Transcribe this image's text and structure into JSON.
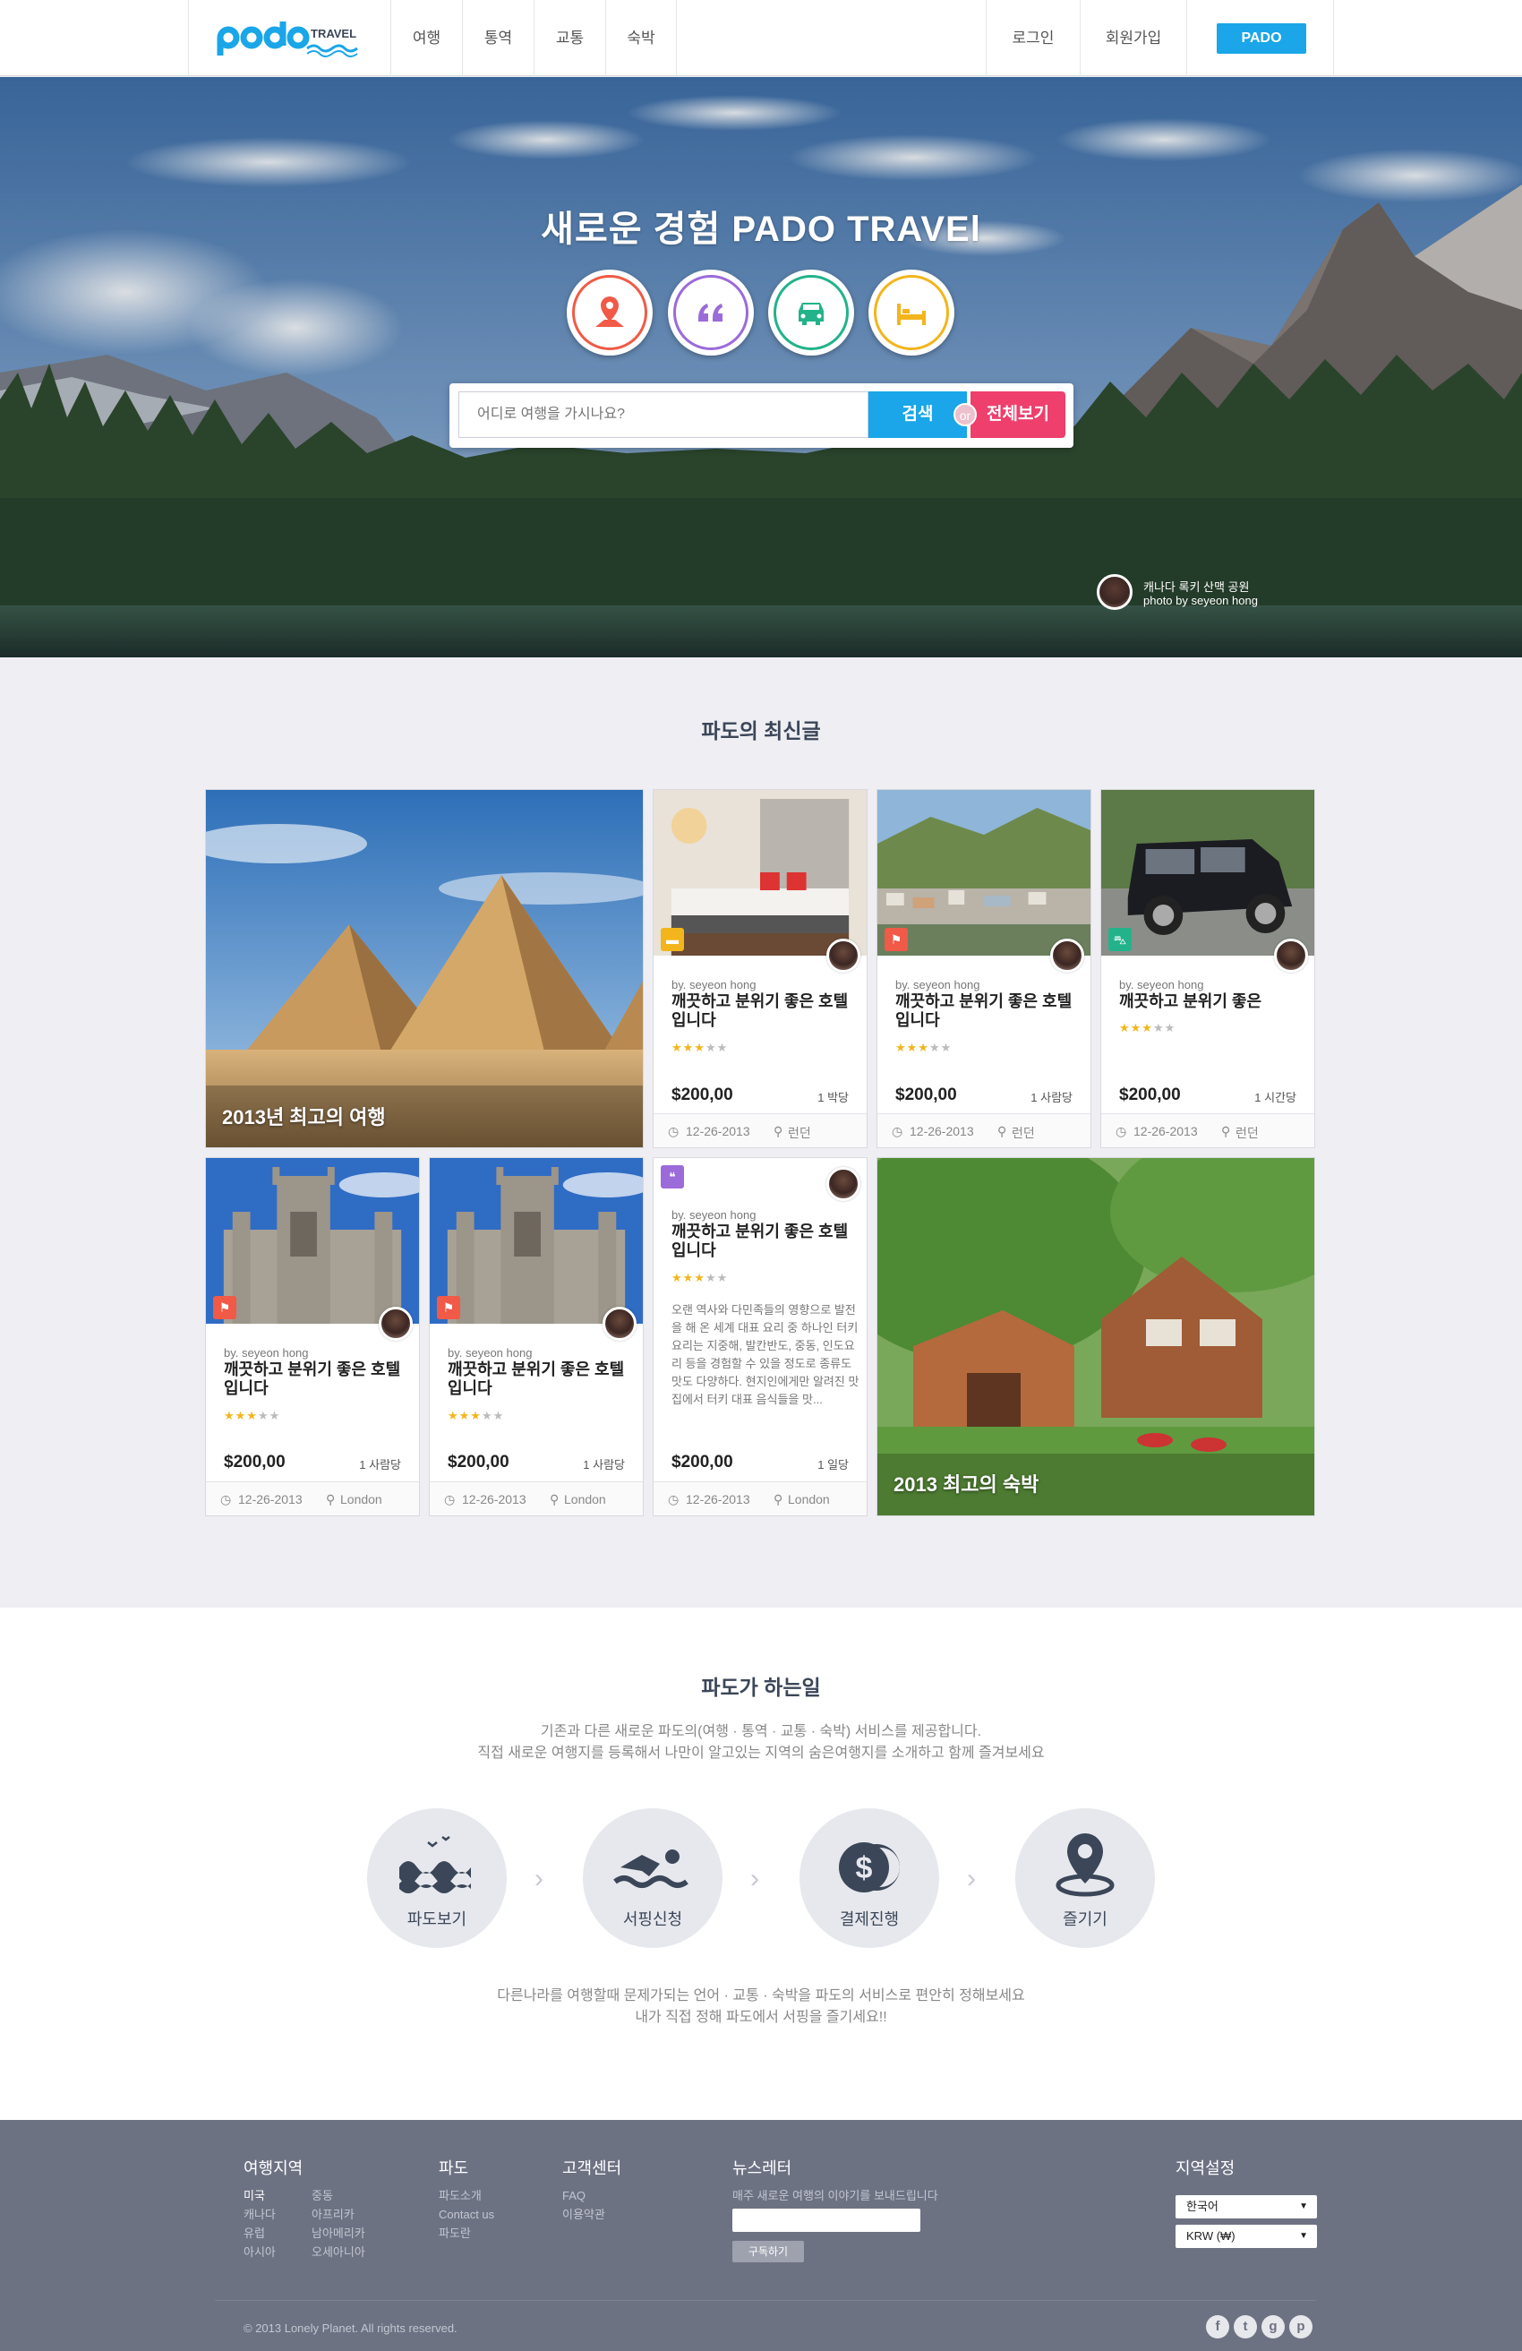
{
  "header": {
    "logo_text": "TRAVEL",
    "nav": [
      "여행",
      "통역",
      "교통",
      "숙박"
    ],
    "login": "로그인",
    "signup": "회원가입",
    "pado_button": "PADO"
  },
  "hero": {
    "title": "새로운 경험 PADO TRAVEl",
    "categories": [
      {
        "icon": "map-pin-icon",
        "color": "#f05a46"
      },
      {
        "icon": "quote-icon",
        "color": "#9b6bd9"
      },
      {
        "icon": "car-icon",
        "color": "#22b38a"
      },
      {
        "icon": "bed-icon",
        "color": "#f2b51c"
      }
    ],
    "search_placeholder": "어디로 여행을 가시나요?",
    "search_button": "검색",
    "or_text": "or",
    "all_button": "전체보기",
    "credit_line1": "캐나다 록키 산맥 공원",
    "credit_line2": "photo by seyeon hong"
  },
  "latest": {
    "title": "파도의 최신글",
    "feature_1": "2013년 최고의 여행",
    "feature_2": "2013 최고의 숙박",
    "cards": [
      {
        "badge": "bed-icon",
        "badge_color": "#f2b51c",
        "by": "by. seyeon hong",
        "title": "깨끗하고 분위기 좋은 호텔 입니다",
        "stars": 3,
        "price": "$200,00",
        "unit": "1 박당",
        "date": "12-26-2013",
        "location": "런던"
      },
      {
        "badge": "map-pin-icon",
        "badge_color": "#f05a46",
        "by": "by. seyeon hong",
        "title": "깨끗하고 분위기 좋은 호텔 입니다",
        "stars": 3,
        "price": "$200,00",
        "unit": "1 사람당",
        "date": "12-26-2013",
        "location": "런던"
      },
      {
        "badge": "car-icon",
        "badge_color": "#22b38a",
        "by": "by. seyeon hong",
        "title": "깨끗하고 분위기 좋은",
        "stars": 3,
        "price": "$200,00",
        "unit": "1 시간당",
        "date": "12-26-2013",
        "location": "런던"
      },
      {
        "badge": "map-pin-icon",
        "badge_color": "#f05a46",
        "by": "by. seyeon hong",
        "title": "깨끗하고 분위기 좋은 호텔 입니다",
        "stars": 3,
        "price": "$200,00",
        "unit": "1 사람당",
        "date": "12-26-2013",
        "location": "London"
      },
      {
        "badge": "map-pin-icon",
        "badge_color": "#f05a46",
        "by": "by. seyeon hong",
        "title": "깨끗하고 분위기 좋은 호텔 입니다",
        "stars": 3,
        "price": "$200,00",
        "unit": "1 사람당",
        "date": "12-26-2013",
        "location": "London"
      },
      {
        "badge": "quote-icon",
        "badge_color": "#9b6bd9",
        "by": "by. seyeon hong",
        "title": "깨끗하고 분위기 좋은 호텔 입니다",
        "stars": 3,
        "desc": "오랜 역사와 다민족들의 영향으로 발전을 해 온 세계 대표 요리 중 하나인 터키요리는 지중해, 발칸반도, 중동, 인도요리 등을 경험할 수 있을 정도로 종류도 맛도 다양하다. 현지인에게만 알려진 맛집에서 터키 대표 음식들을 맛...",
        "price": "$200,00",
        "unit": "1 일당",
        "date": "12-26-2013",
        "location": "London"
      }
    ]
  },
  "what": {
    "title": "파도가 하는일",
    "intro_line1": "기존과 다른 새로운 파도의(여행 · 통역 · 교통 · 숙박) 서비스를 제공합니다.",
    "intro_line2": "직접 새로운 여행지를 등록해서 나만이 알고있는 지역의 숨은여행지를 소개하고 함께 즐겨보세요",
    "steps": [
      {
        "icon": "waves-icon",
        "label": "파도보기"
      },
      {
        "icon": "swimmer-icon",
        "label": "서핑신청"
      },
      {
        "icon": "coins-icon",
        "label": "결제진행"
      },
      {
        "icon": "location-icon",
        "label": "즐기기"
      }
    ],
    "outro_line1": "다른나라를 여행할때 문제가되는 언어 · 교통 · 숙박을 파도의 서비스로 편안히 정해보세요",
    "outro_line2": "내가 직접 정해 파도에서 서핑을 즐기세요!!"
  },
  "footer": {
    "regions_title": "여행지역",
    "regions_col1": [
      "미국",
      "캐나다",
      "유럽",
      "아시아"
    ],
    "regions_col2": [
      "중동",
      "아프리카",
      "남아메리카",
      "오세아니아"
    ],
    "pado_title": "파도",
    "pado_links": [
      "파도소개",
      "Contact us",
      "파도란"
    ],
    "support_title": "고객센터",
    "support_links": [
      "FAQ",
      "이용약관"
    ],
    "newsletter_title": "뉴스레터",
    "newsletter_desc": "매주 새로운 여행의 이야기를 보내드립니다",
    "subscribe": "구독하기",
    "region_title": "지역설정",
    "language": "한국어",
    "currency": "KRW (₩)",
    "copyright": "© 2013 Lonely Planet. All rights reserved.",
    "social": [
      "f",
      "t",
      "g",
      "p"
    ]
  }
}
